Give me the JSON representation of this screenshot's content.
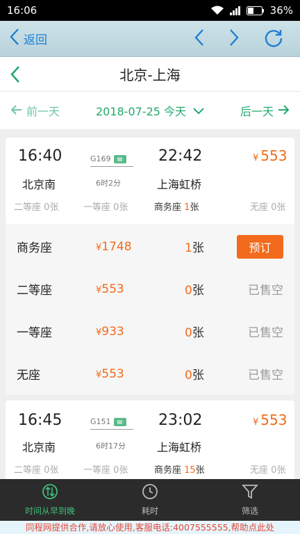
{
  "status_bar": {
    "time": "16:06",
    "battery": "36%"
  },
  "browser_bar": {
    "back_label": "返回"
  },
  "title_bar": {
    "title": "北京-上海"
  },
  "date_bar": {
    "prev_label": "前一天",
    "date": "2018-07-25 今天",
    "next_label": "后一天"
  },
  "trains": [
    {
      "depart_time": "16:40",
      "train_no": "G169",
      "arrive_time": "22:42",
      "price": "553",
      "from_station": "北京南",
      "duration": "6时2分",
      "to_station": "上海虹桥",
      "seats": [
        {
          "label": "二等座",
          "count": "0",
          "unit": "张"
        },
        {
          "label": "一等座",
          "count": "0",
          "unit": "张"
        },
        {
          "label": "商务座",
          "count": "1",
          "unit": "张"
        },
        {
          "label": "无座",
          "count": "0",
          "unit": "张"
        }
      ]
    },
    {
      "depart_time": "16:45",
      "train_no": "G151",
      "arrive_time": "23:02",
      "price": "553",
      "from_station": "北京南",
      "duration": "6时17分",
      "to_station": "上海虹桥",
      "seats": [
        {
          "label": "二等座",
          "count": "0",
          "unit": "张"
        },
        {
          "label": "一等座",
          "count": "0",
          "unit": "张"
        },
        {
          "label": "商务座",
          "count": "15",
          "unit": "张"
        },
        {
          "label": "无座",
          "count": "0",
          "unit": "张"
        }
      ]
    }
  ],
  "yen_symbol": "¥",
  "seat_details": [
    {
      "name": "商务座",
      "price": "1748",
      "count": "1",
      "unit": "张",
      "action": "预订"
    },
    {
      "name": "二等座",
      "price": "553",
      "count": "0",
      "unit": "张",
      "status": "已售空"
    },
    {
      "name": "一等座",
      "price": "933",
      "count": "0",
      "unit": "张",
      "status": "已售空"
    },
    {
      "name": "无座",
      "price": "553",
      "count": "0",
      "unit": "张",
      "status": "已售空"
    }
  ],
  "bottom_nav": [
    {
      "label": "时间从早到晚",
      "icon": "sort-icon",
      "active": true
    },
    {
      "label": "耗时",
      "icon": "clock-icon",
      "active": false
    },
    {
      "label": "筛选",
      "icon": "filter-icon",
      "active": false
    }
  ],
  "footer_text": "同程网提供合作,请放心使用,客服电话:4007555555,帮助点此处",
  "colors": {
    "accent": "#22a86e",
    "price": "#f26a1b",
    "book_button": "#f26a1b",
    "nav_bg": "#2b2b2b"
  }
}
